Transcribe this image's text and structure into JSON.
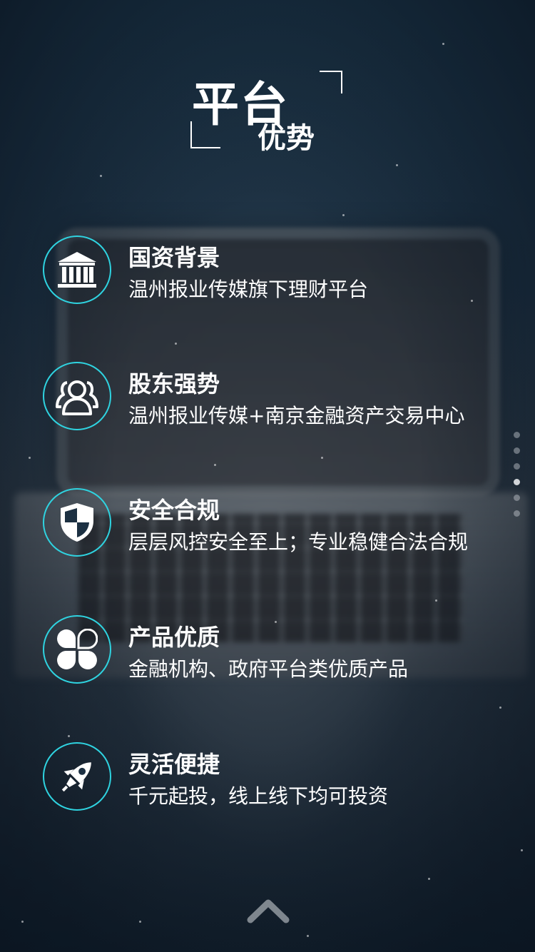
{
  "header": {
    "title_line1": "平台",
    "title_line2": "优势"
  },
  "features": [
    {
      "icon": "bank-icon",
      "title": "国资背景",
      "desc": "温州报业传媒旗下理财平台"
    },
    {
      "icon": "users-icon",
      "title": "股东强势",
      "desc": "温州报业传媒+南京金融资产交易中心"
    },
    {
      "icon": "shield-icon",
      "title": "安全合规",
      "desc": "层层风控安全至上；专业稳健合法合规"
    },
    {
      "icon": "clover-icon",
      "title": "产品优质",
      "desc": "金融机构、政府平台类优质产品"
    },
    {
      "icon": "rocket-icon",
      "title": "灵活便捷",
      "desc": "千元起投，线上线下均可投资"
    }
  ],
  "pager": {
    "count": 6,
    "active_index": 3
  },
  "colors": {
    "accent": "#2fd3e0",
    "text": "#ffffff",
    "background": "#17283a"
  }
}
